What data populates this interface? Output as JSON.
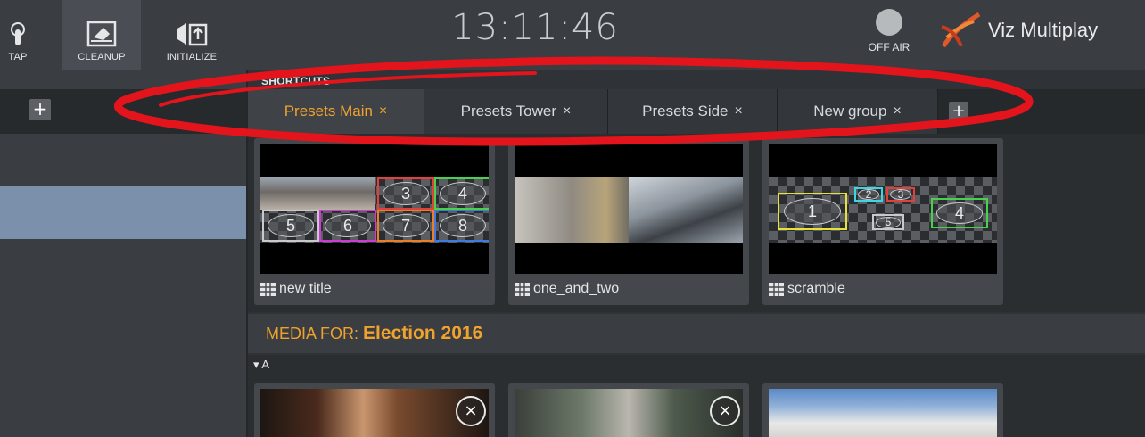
{
  "toolbar": {
    "tap_label": "TAP",
    "cleanup_label": "CLEANUP",
    "initialize_label": "INITIALIZE"
  },
  "clock": "13:11:46",
  "status": {
    "off_air_label": "OFF AIR"
  },
  "brand": {
    "name": "Viz Multiplay",
    "accent": "#e2582a"
  },
  "left_panel": {
    "add_symbol": "+"
  },
  "shortcuts": {
    "section_label": "SHORTCUTS",
    "tabs": [
      {
        "label": "Presets Main",
        "close": "×",
        "active": true
      },
      {
        "label": "Presets Tower",
        "close": "×",
        "active": false
      },
      {
        "label": "Presets Side",
        "close": "×",
        "active": false
      },
      {
        "label": "New group",
        "close": "×",
        "active": false
      }
    ],
    "add_symbol": "+",
    "active_color": "#f0a22e"
  },
  "presets": [
    {
      "name": "new title",
      "slots": [
        "3",
        "4",
        "5",
        "6",
        "7",
        "8"
      ]
    },
    {
      "name": "one_and_two"
    },
    {
      "name": "scramble",
      "slots": [
        "1",
        "2",
        "3",
        "5",
        "4"
      ]
    }
  ],
  "media": {
    "prefix": "MEDIA FOR:",
    "title": "Election 2016",
    "section": "A",
    "close_symbol": "×"
  },
  "annotation_color": "#e3141c"
}
